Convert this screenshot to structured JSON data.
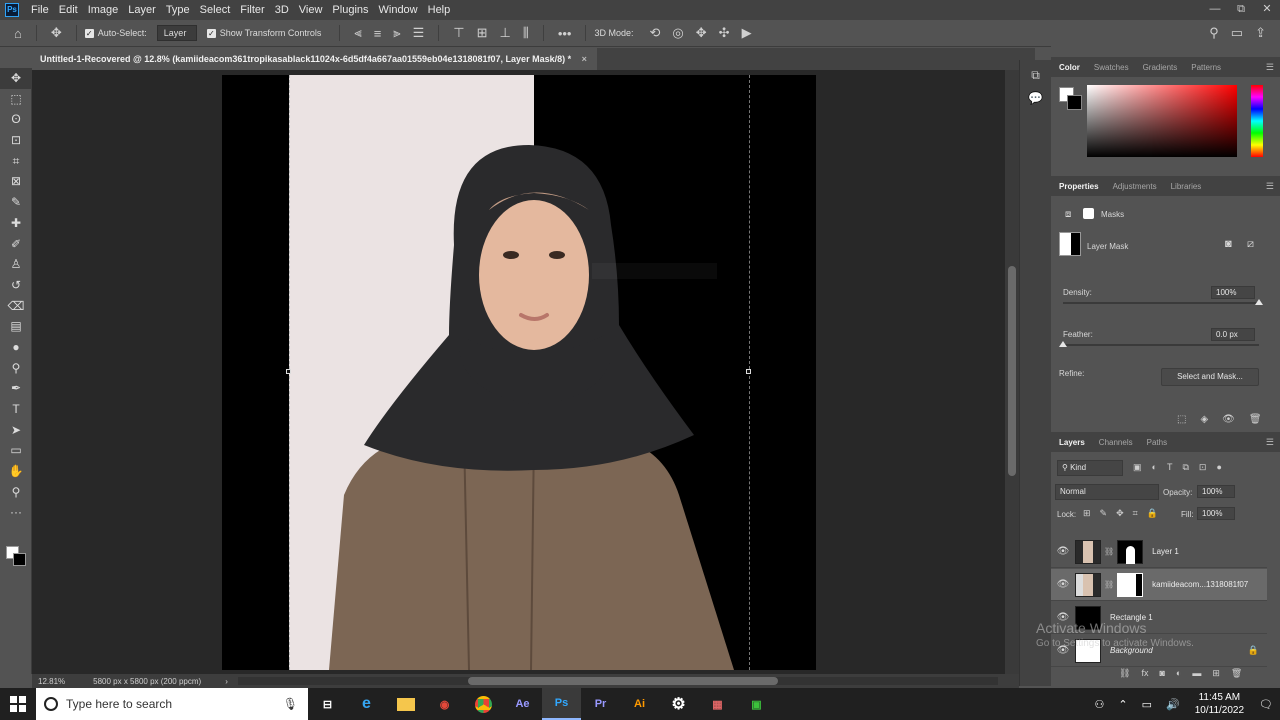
{
  "app": {
    "logo": "Ps"
  },
  "menu": [
    "File",
    "Edit",
    "Image",
    "Layer",
    "Type",
    "Select",
    "Filter",
    "3D",
    "View",
    "Plugins",
    "Window",
    "Help"
  ],
  "window_controls": [
    "—",
    "⧉",
    "✕"
  ],
  "options_bar": {
    "auto_select_label": "Auto-Select:",
    "auto_select_value": "Layer",
    "show_transform_label": "Show Transform Controls",
    "mode_3d_label": "3D Mode:"
  },
  "document": {
    "tab_title": "Untitled-1-Recovered @ 12.8% (kamiideacom361tropikasablack11024x-6d5df4a667aa01559eb04e1318081f07, Layer Mask/8) *",
    "zoom": "12.81%",
    "size_info": "5800 px x 5800 px (200 ppcm)"
  },
  "tools": [
    "move-tool",
    "marquee-tool",
    "lasso-tool",
    "object-select-tool",
    "crop-tool",
    "frame-tool",
    "eyedropper-tool",
    "healing-tool",
    "brush-tool",
    "stamp-tool",
    "history-brush-tool",
    "eraser-tool",
    "gradient-tool",
    "blur-tool",
    "dodge-tool",
    "pen-tool",
    "type-tool",
    "path-select-tool",
    "rectangle-tool",
    "hand-tool",
    "zoom-tool",
    "more-tools"
  ],
  "tool_glyphs": [
    "✥",
    "⬚",
    "ʘ",
    "⊡",
    "⌗",
    "⊠",
    "✎",
    "✚",
    "✐",
    "♙",
    "↺",
    "⌫",
    "▤",
    "●",
    "⚲",
    "✒",
    "T",
    "➤",
    "▭",
    "✋",
    "⚲",
    "···"
  ],
  "color_panel": {
    "tabs": [
      "Color",
      "Swatches",
      "Gradients",
      "Patterns"
    ]
  },
  "properties_panel": {
    "tabs": [
      "Properties",
      "Adjustments",
      "Libraries"
    ],
    "masks_label": "Masks",
    "layer_mask_label": "Layer Mask",
    "density_label": "Density:",
    "density_value": "100%",
    "density_level": 1.0,
    "feather_label": "Feather:",
    "feather_value": "0.0 px",
    "feather_level": 0.0,
    "refine_label": "Refine:",
    "select_and_mask_label": "Select and Mask..."
  },
  "layers_panel": {
    "tabs": [
      "Layers",
      "Channels",
      "Paths"
    ],
    "filter_kind": "Kind",
    "blend_mode": "Normal",
    "opacity_label": "Opacity:",
    "opacity_value": "100%",
    "lock_label": "Lock:",
    "fill_label": "Fill:",
    "fill_value": "100%",
    "layers": [
      {
        "name": "Layer 1",
        "selected": false
      },
      {
        "name": "kamiideacom...1318081f07",
        "selected": true
      },
      {
        "name": "Rectangle 1",
        "selected": false
      },
      {
        "name": "Background",
        "selected": false
      }
    ]
  },
  "watermark": {
    "line1": "Activate Windows",
    "line2": "Go to Settings to activate Windows."
  },
  "taskbar": {
    "search_placeholder": "Type here to search",
    "apps": [
      "Ae",
      "Ps",
      "Pr",
      "Ai"
    ],
    "time": "11:45 AM",
    "date": "10/11/2022"
  },
  "colors": {
    "ps_blue": "#31a8ff",
    "canvas_bg": "#282828",
    "panel_bg": "#535353"
  }
}
